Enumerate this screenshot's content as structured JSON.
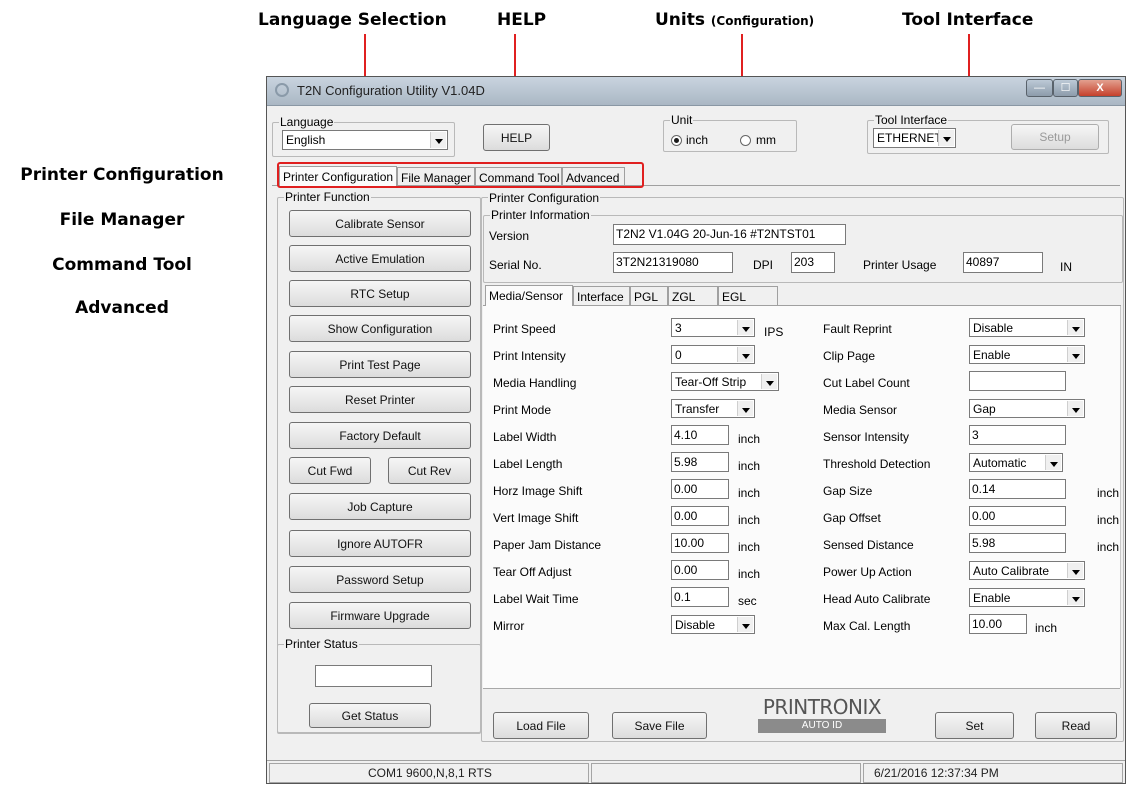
{
  "annotations": {
    "top": [
      {
        "key": "lang",
        "label": "Language Selection",
        "sub": ""
      },
      {
        "key": "help",
        "label": "HELP",
        "sub": ""
      },
      {
        "key": "units",
        "label": "Units",
        "sub": "(Configuration)"
      },
      {
        "key": "tool",
        "label": "Tool Interface",
        "sub": ""
      }
    ],
    "left": [
      "Printer Configuration",
      "File Manager",
      "Command Tool",
      "Advanced"
    ],
    "arrow_color": "#e02020"
  },
  "window": {
    "title": "T2N Configuration Utility V1.04D",
    "controls": {
      "minimize": "—",
      "maximize": "☐",
      "close": "X"
    }
  },
  "language": {
    "group_label": "Language",
    "value": "English"
  },
  "help_button": "HELP",
  "unit": {
    "group_label": "Unit",
    "options": [
      {
        "label": "inch",
        "selected": true
      },
      {
        "label": "mm",
        "selected": false
      }
    ]
  },
  "tool_interface": {
    "group_label": "Tool Interface",
    "value": "ETHERNET",
    "setup_label": "Setup"
  },
  "main_tabs": [
    {
      "label": "Printer Configuration",
      "active": true
    },
    {
      "label": "File Manager",
      "active": false
    },
    {
      "label": "Command Tool",
      "active": false
    },
    {
      "label": "Advanced",
      "active": false
    }
  ],
  "printer_function": {
    "group_label": "Printer Function",
    "buttons": {
      "calibrate": "Calibrate Sensor",
      "emulation": "Active Emulation",
      "rtc": "RTC Setup",
      "show_config": "Show Configuration",
      "test_page": "Print Test Page",
      "reset": "Reset Printer",
      "factory": "Factory Default",
      "cut_fwd": "Cut Fwd",
      "cut_rev": "Cut Rev",
      "job_capture": "Job Capture",
      "ignore_autofr": "Ignore AUTOFR",
      "password": "Password Setup",
      "firmware": "Firmware Upgrade"
    }
  },
  "printer_status": {
    "group_label": "Printer Status",
    "value": "",
    "button": "Get Status"
  },
  "printer_configuration": {
    "group_label": "Printer Configuration",
    "info_group_label": "Printer Information",
    "version_label": "Version",
    "version_value": "T2N2 V1.04G 20-Jun-16 #T2NTST01",
    "serial_label": "Serial No.",
    "serial_value": "3T2N21319080",
    "dpi_label": "DPI",
    "dpi_value": "203",
    "usage_label": "Printer Usage",
    "usage_value": "40897",
    "usage_unit": "IN"
  },
  "sub_tabs": [
    {
      "label": "Media/Sensor",
      "active": true
    },
    {
      "label": "Interface",
      "active": false
    },
    {
      "label": "PGL",
      "active": false
    },
    {
      "label": "ZGL",
      "active": false
    },
    {
      "label": "EGL",
      "active": false
    }
  ],
  "media_sensor": {
    "left": [
      {
        "label": "Print Speed",
        "type": "select",
        "value": "3",
        "unit": "IPS"
      },
      {
        "label": "Print Intensity",
        "type": "select",
        "value": "0",
        "unit": ""
      },
      {
        "label": "Media Handling",
        "type": "select",
        "value": "Tear-Off Strip",
        "unit": ""
      },
      {
        "label": "Print Mode",
        "type": "select",
        "value": "Transfer",
        "unit": ""
      },
      {
        "label": "Label Width",
        "type": "input",
        "value": "4.10",
        "unit": "inch"
      },
      {
        "label": "Label Length",
        "type": "input",
        "value": "5.98",
        "unit": "inch"
      },
      {
        "label": "Horz Image Shift",
        "type": "input",
        "value": "0.00",
        "unit": "inch"
      },
      {
        "label": "Vert Image Shift",
        "type": "input",
        "value": "0.00",
        "unit": "inch"
      },
      {
        "label": "Paper Jam Distance",
        "type": "input",
        "value": "10.00",
        "unit": "inch"
      },
      {
        "label": "Tear Off Adjust",
        "type": "input",
        "value": "0.00",
        "unit": "inch"
      },
      {
        "label": "Label Wait Time",
        "type": "input",
        "value": "0.1",
        "unit": "sec"
      },
      {
        "label": "Mirror",
        "type": "select",
        "value": "Disable",
        "unit": ""
      }
    ],
    "right": [
      {
        "label": "Fault Reprint",
        "type": "select",
        "value": "Disable",
        "unit": ""
      },
      {
        "label": "Clip Page",
        "type": "select",
        "value": "Enable",
        "unit": ""
      },
      {
        "label": "Cut Label Count",
        "type": "input",
        "value": "",
        "unit": ""
      },
      {
        "label": "Media Sensor",
        "type": "select",
        "value": "Gap",
        "unit": ""
      },
      {
        "label": "Sensor Intensity",
        "type": "input",
        "value": "3",
        "unit": ""
      },
      {
        "label": "Threshold Detection",
        "type": "select",
        "value": "Automatic",
        "unit": ""
      },
      {
        "label": "Gap Size",
        "type": "input",
        "value": "0.14",
        "unit": "inch"
      },
      {
        "label": "Gap Offset",
        "type": "input",
        "value": "0.00",
        "unit": "inch"
      },
      {
        "label": "Sensed Distance",
        "type": "input",
        "value": "5.98",
        "unit": "inch"
      },
      {
        "label": "Power Up Action",
        "type": "select",
        "value": "Auto Calibrate",
        "unit": ""
      },
      {
        "label": "Head Auto Calibrate",
        "type": "select",
        "value": "Enable",
        "unit": ""
      },
      {
        "label": "Max Cal. Length",
        "type": "input",
        "value": "10.00",
        "unit": "inch"
      }
    ]
  },
  "bottom_buttons": {
    "load": "Load File",
    "save": "Save File",
    "set": "Set",
    "read": "Read"
  },
  "logo": {
    "brand": "PRINTRONIX",
    "sub": "AUTO ID"
  },
  "status_bar": {
    "port": "COM1 9600,N,8,1 RTS",
    "middle": "",
    "datetime": "6/21/2016 12:37:34 PM"
  }
}
